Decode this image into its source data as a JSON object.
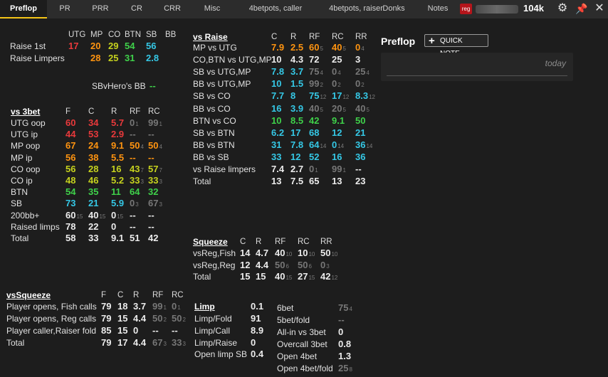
{
  "tabs": [
    "Preflop",
    "PR",
    "PRR",
    "CR",
    "CRR",
    "Misc",
    "4betpots, caller",
    "4betpots, raiser",
    "Donks",
    "Notes"
  ],
  "header": {
    "badge": "reg",
    "stack": "104k"
  },
  "colors": {
    "red": "#e8393b",
    "orange": "#ff9410",
    "yellow": "#c6d21e",
    "green": "#3fd14a",
    "cyan": "#35c8e6",
    "gray": "#777777",
    "accent": "#f5c518"
  },
  "icons": {
    "gear": "gear-icon",
    "pin": "pin-icon",
    "close": "close-icon",
    "plus": "plus-icon"
  },
  "notes_panel": {
    "title": "Preflop",
    "quick_note": "QUICK NOTE...",
    "date": "today"
  },
  "rfi": {
    "headers": [
      "UTG",
      "MP",
      "CO",
      "BTN",
      "SB",
      "BB"
    ],
    "rows": [
      {
        "label": "Raise 1st",
        "cells": [
          [
            "17",
            "",
            "red"
          ],
          [
            "20",
            "",
            "orange"
          ],
          [
            "29",
            "",
            "yellow"
          ],
          [
            "54",
            "",
            "green"
          ],
          [
            "56",
            "",
            "cyan"
          ]
        ]
      },
      {
        "label": "Raise Limpers",
        "cells": [
          null,
          [
            "28",
            "",
            "orange"
          ],
          [
            "25",
            "",
            "yellow"
          ],
          [
            "31",
            "",
            "green"
          ],
          [
            "2.8",
            "",
            "cyan"
          ]
        ]
      }
    ]
  },
  "sbvhero": {
    "label": "SBvHero's BB",
    "value": "--"
  },
  "vs3bet": {
    "title": "vs 3bet",
    "headers": [
      "F",
      "C",
      "R",
      "RF",
      "RC"
    ],
    "rows": [
      {
        "label": "UTG oop",
        "cells": [
          [
            "60",
            "",
            "red"
          ],
          [
            "34",
            "",
            "red"
          ],
          [
            "5.7",
            "",
            "red"
          ],
          [
            "0",
            "1",
            "gray"
          ],
          [
            "99",
            "1",
            "gray"
          ]
        ]
      },
      {
        "label": "UTG ip",
        "cells": [
          [
            "44",
            "",
            "red"
          ],
          [
            "53",
            "",
            "red"
          ],
          [
            "2.9",
            "",
            "red"
          ],
          [
            "--",
            "",
            "gray"
          ],
          [
            "--",
            "",
            "gray"
          ]
        ]
      },
      {
        "label": "MP oop",
        "cells": [
          [
            "67",
            "",
            "orange"
          ],
          [
            "24",
            "",
            "orange"
          ],
          [
            "9.1",
            "",
            "orange"
          ],
          [
            "50",
            "4",
            "orange"
          ],
          [
            "50",
            "4",
            "orange"
          ]
        ]
      },
      {
        "label": "MP ip",
        "cells": [
          [
            "56",
            "",
            "orange"
          ],
          [
            "38",
            "",
            "orange"
          ],
          [
            "5.5",
            "",
            "orange"
          ],
          [
            "--",
            "",
            "orange"
          ],
          [
            "--",
            "",
            "orange"
          ]
        ]
      },
      {
        "label": "CO oop",
        "cells": [
          [
            "56",
            "",
            "yellow"
          ],
          [
            "28",
            "",
            "yellow"
          ],
          [
            "16",
            "",
            "yellow"
          ],
          [
            "43",
            "7",
            "yellow"
          ],
          [
            "57",
            "7",
            "yellow"
          ]
        ]
      },
      {
        "label": "CO ip",
        "cells": [
          [
            "48",
            "",
            "yellow"
          ],
          [
            "46",
            "",
            "yellow"
          ],
          [
            "5.2",
            "",
            "yellow"
          ],
          [
            "33",
            "3",
            "yellow"
          ],
          [
            "33",
            "3",
            "yellow"
          ]
        ]
      },
      {
        "label": "BTN",
        "cells": [
          [
            "54",
            "",
            "green"
          ],
          [
            "35",
            "",
            "green"
          ],
          [
            "11",
            "",
            "green"
          ],
          [
            "64",
            "",
            "green"
          ],
          [
            "32",
            "",
            "green"
          ]
        ]
      },
      {
        "label": "SB",
        "cells": [
          [
            "73",
            "",
            "cyan"
          ],
          [
            "21",
            "",
            "cyan"
          ],
          [
            "5.9",
            "",
            "cyan"
          ],
          [
            "0",
            "3",
            "gray"
          ],
          [
            "67",
            "3",
            "gray"
          ]
        ]
      },
      {
        "label": "200bb+",
        "cells": [
          [
            "60",
            "15",
            ""
          ],
          [
            "40",
            "15",
            ""
          ],
          [
            "0",
            "15",
            ""
          ],
          [
            "--",
            "",
            ""
          ],
          [
            "--",
            "",
            ""
          ]
        ]
      },
      {
        "label": "Raised limps",
        "cells": [
          [
            "78",
            "",
            ""
          ],
          [
            "22",
            "",
            ""
          ],
          [
            "0",
            "",
            ""
          ],
          [
            "--",
            "",
            ""
          ],
          [
            "--",
            "",
            ""
          ]
        ]
      },
      {
        "label": "Total",
        "cells": [
          [
            "58",
            "",
            ""
          ],
          [
            "33",
            "",
            ""
          ],
          [
            "9.1",
            "",
            ""
          ],
          [
            "51",
            "",
            ""
          ],
          [
            "42",
            "",
            ""
          ]
        ]
      }
    ]
  },
  "vsraise": {
    "title": "vs Raise",
    "headers": [
      "C",
      "R",
      "RF",
      "RC",
      "RR"
    ],
    "rows": [
      {
        "label": "MP vs UTG",
        "cells": [
          [
            "7.9",
            "",
            "orange"
          ],
          [
            "2.5",
            "",
            "orange"
          ],
          [
            "60",
            "5",
            "orange"
          ],
          [
            "40",
            "5",
            "orange"
          ],
          [
            "0",
            "4",
            "orange"
          ]
        ]
      },
      {
        "label": "CO,BTN vs UTG,MP",
        "cells": [
          [
            "10",
            "",
            ""
          ],
          [
            "4.3",
            "",
            ""
          ],
          [
            "72",
            "",
            ""
          ],
          [
            "25",
            "",
            ""
          ],
          [
            "3",
            "",
            ""
          ]
        ]
      },
      {
        "label": "SB vs UTG,MP",
        "cells": [
          [
            "7.8",
            "",
            "cyan"
          ],
          [
            "3.7",
            "",
            "cyan"
          ],
          [
            "75",
            "4",
            "gray"
          ],
          [
            "0",
            "4",
            "gray"
          ],
          [
            "25",
            "4",
            "gray"
          ]
        ]
      },
      {
        "label": "BB vs UTG,MP",
        "cells": [
          [
            "10",
            "",
            "cyan"
          ],
          [
            "1.5",
            "",
            "cyan"
          ],
          [
            "99",
            "2",
            "gray"
          ],
          [
            "0",
            "2",
            "gray"
          ],
          [
            "0",
            "2",
            "gray"
          ]
        ]
      },
      {
        "label": "SB vs CO",
        "cells": [
          [
            "7.7",
            "",
            "cyan"
          ],
          [
            "8",
            "",
            "cyan"
          ],
          [
            "75",
            "12",
            "cyan"
          ],
          [
            "17",
            "12",
            "cyan"
          ],
          [
            "8.3",
            "12",
            "cyan"
          ]
        ]
      },
      {
        "label": "BB vs CO",
        "cells": [
          [
            "16",
            "",
            "cyan"
          ],
          [
            "3.9",
            "",
            "cyan"
          ],
          [
            "40",
            "5",
            "gray"
          ],
          [
            "20",
            "5",
            "gray"
          ],
          [
            "40",
            "5",
            "gray"
          ]
        ]
      },
      {
        "label": "BTN vs CO",
        "cells": [
          [
            "10",
            "",
            "green"
          ],
          [
            "8.5",
            "",
            "green"
          ],
          [
            "42",
            "",
            "green"
          ],
          [
            "9.1",
            "",
            "green"
          ],
          [
            "50",
            "",
            "green"
          ]
        ]
      },
      {
        "label": "SB vs BTN",
        "cells": [
          [
            "6.2",
            "",
            "cyan"
          ],
          [
            "17",
            "",
            "cyan"
          ],
          [
            "68",
            "",
            "cyan"
          ],
          [
            "12",
            "",
            "cyan"
          ],
          [
            "21",
            "",
            "cyan"
          ]
        ]
      },
      {
        "label": "BB vs BTN",
        "cells": [
          [
            "31",
            "",
            "cyan"
          ],
          [
            "7.8",
            "",
            "cyan"
          ],
          [
            "64",
            "14",
            "cyan"
          ],
          [
            "0",
            "14",
            "cyan"
          ],
          [
            "36",
            "14",
            "cyan"
          ]
        ]
      },
      {
        "label": "BB vs SB",
        "cells": [
          [
            "33",
            "",
            "cyan"
          ],
          [
            "12",
            "",
            "cyan"
          ],
          [
            "52",
            "",
            "cyan"
          ],
          [
            "16",
            "",
            "cyan"
          ],
          [
            "36",
            "",
            "cyan"
          ]
        ]
      },
      {
        "label": "vs Raise limpers",
        "cells": [
          [
            "7.4",
            "",
            ""
          ],
          [
            "2.7",
            "",
            ""
          ],
          [
            "0",
            "1",
            "gray"
          ],
          [
            "99",
            "1",
            "gray"
          ],
          [
            "--",
            "",
            ""
          ]
        ]
      },
      {
        "label": "Total",
        "cells": [
          [
            "13",
            "",
            ""
          ],
          [
            "7.5",
            "",
            ""
          ],
          [
            "65",
            "",
            ""
          ],
          [
            "13",
            "",
            ""
          ],
          [
            "23",
            "",
            ""
          ]
        ]
      }
    ]
  },
  "squeeze": {
    "title": "Squeeze",
    "headers": [
      "C",
      "R",
      "RF",
      "RC",
      "RR"
    ],
    "rows": [
      {
        "label": "vsReg,Fish",
        "cells": [
          [
            "14",
            "",
            ""
          ],
          [
            "4.7",
            "",
            ""
          ],
          [
            "40",
            "10",
            ""
          ],
          [
            "10",
            "10",
            ""
          ],
          [
            "50",
            "10",
            ""
          ]
        ]
      },
      {
        "label": "vsReg,Reg",
        "cells": [
          [
            "12",
            "",
            ""
          ],
          [
            "4.4",
            "",
            ""
          ],
          [
            "50",
            "6",
            "gray"
          ],
          [
            "50",
            "6",
            "gray"
          ],
          [
            "0",
            "3",
            "gray"
          ]
        ]
      },
      {
        "label": "Total",
        "cells": [
          [
            "15",
            "",
            ""
          ],
          [
            "15",
            "",
            ""
          ],
          [
            "40",
            "15",
            ""
          ],
          [
            "27",
            "15",
            ""
          ],
          [
            "42",
            "12",
            ""
          ]
        ]
      }
    ]
  },
  "vssqueeze": {
    "title": "vsSqueeze",
    "headers": [
      "F",
      "C",
      "R",
      "RF",
      "RC"
    ],
    "rows": [
      {
        "label": "Player opens, Fish calls",
        "cells": [
          [
            "79",
            "",
            ""
          ],
          [
            "18",
            "",
            ""
          ],
          [
            "3.7",
            "",
            ""
          ],
          [
            "99",
            "1",
            "gray"
          ],
          [
            "0",
            "1",
            "gray"
          ]
        ]
      },
      {
        "label": "Player opens, Reg calls",
        "cells": [
          [
            "79",
            "",
            ""
          ],
          [
            "15",
            "",
            ""
          ],
          [
            "4.4",
            "",
            ""
          ],
          [
            "50",
            "2",
            "gray"
          ],
          [
            "50",
            "2",
            "gray"
          ]
        ]
      },
      {
        "label": "Player caller,Raiser fold",
        "cells": [
          [
            "85",
            "",
            ""
          ],
          [
            "15",
            "",
            ""
          ],
          [
            "0",
            "",
            ""
          ],
          [
            "--",
            "",
            ""
          ],
          [
            "--",
            "",
            ""
          ]
        ]
      },
      {
        "label": "Total",
        "cells": [
          [
            "79",
            "",
            ""
          ],
          [
            "17",
            "",
            ""
          ],
          [
            "4.4",
            "",
            ""
          ],
          [
            "67",
            "3",
            "gray"
          ],
          [
            "33",
            "3",
            "gray"
          ]
        ]
      }
    ]
  },
  "limp": {
    "title": "Limp",
    "rows": [
      {
        "label": "Limp/Fold",
        "value": [
          "91",
          "",
          ""
        ]
      },
      {
        "label": "Limp/Call",
        "value": [
          "8.9",
          "",
          ""
        ]
      },
      {
        "label": "Limp/Raise",
        "value": [
          "0",
          "",
          ""
        ]
      },
      {
        "label": "Open limp SB",
        "value": [
          "0.4",
          "",
          ""
        ]
      }
    ],
    "title_value": [
      "0.1",
      "",
      ""
    ]
  },
  "misc": {
    "rows": [
      {
        "label": "6bet",
        "value": [
          "75",
          "4",
          "gray"
        ]
      },
      {
        "label": "5bet/fold",
        "value": [
          "--",
          "",
          "gray"
        ]
      },
      {
        "label": "All-in vs 3bet",
        "value": [
          "0",
          "",
          ""
        ]
      },
      {
        "label": "Overcall 3bet",
        "value": [
          "0.8",
          "",
          ""
        ]
      },
      {
        "label": "Open 4bet",
        "value": [
          "1.3",
          "",
          ""
        ]
      },
      {
        "label": "Open 4bet/fold",
        "value": [
          "25",
          "8",
          "gray"
        ]
      }
    ]
  }
}
